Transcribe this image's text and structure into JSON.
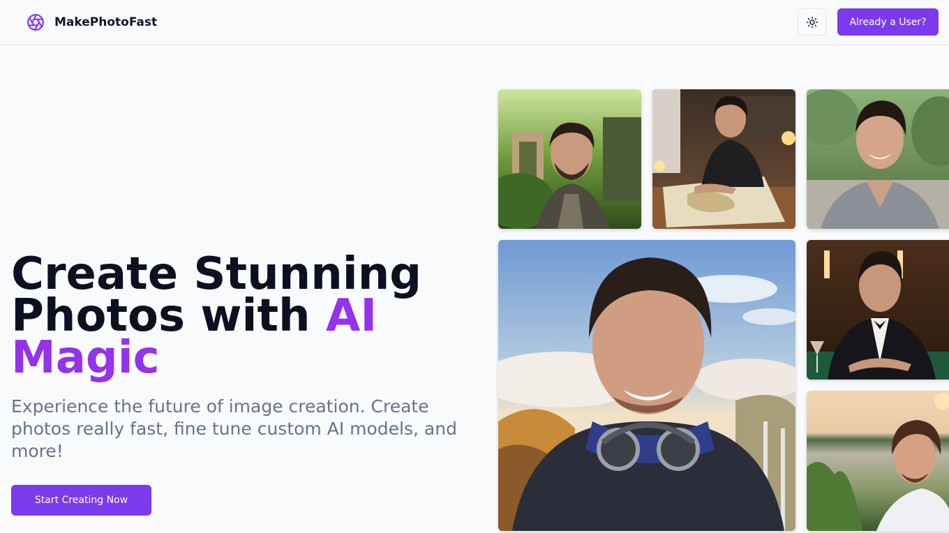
{
  "brand": {
    "name": "MakePhotoFast",
    "icon": "aperture-icon"
  },
  "nav": {
    "theme_toggle_icon": "sun-icon",
    "login_label": "Already a User?"
  },
  "hero": {
    "title_line1": "Create Stunning",
    "title_line2": "Photos with ",
    "title_accent": "AI",
    "title_accent2": "Magic",
    "subtitle": "Experience the future of image creation. Create photos really fast, fine tune custom AI models, and more!",
    "cta_label": "Start Creating Now"
  },
  "colors": {
    "accent": "#7c3aed",
    "accent_text": "#9333ea",
    "muted_text": "#64748b"
  },
  "gallery": [
    {
      "name": "photo-forest-selfie"
    },
    {
      "name": "photo-map-desk"
    },
    {
      "name": "photo-garden-portrait"
    },
    {
      "name": "photo-mountain-selfie"
    },
    {
      "name": "photo-casino-tuxedo"
    },
    {
      "name": "photo-lakeside-sunset"
    }
  ]
}
